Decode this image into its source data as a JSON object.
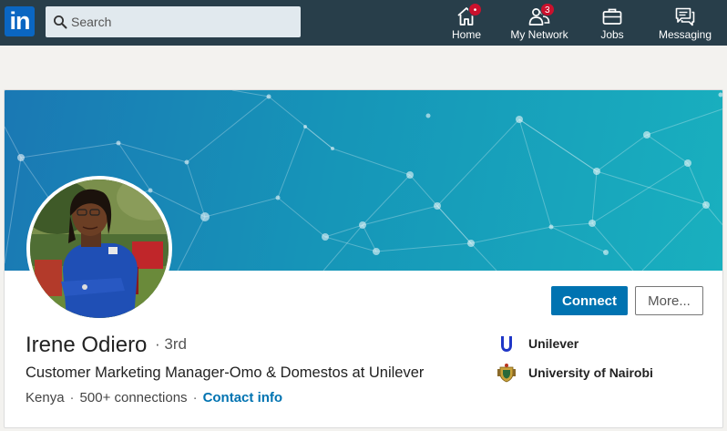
{
  "nav": {
    "logo_text": "in",
    "search_placeholder": "Search",
    "items": [
      {
        "label": "Home",
        "icon": "home-icon",
        "badge": "•"
      },
      {
        "label": "My Network",
        "icon": "network-icon",
        "badge": "3"
      },
      {
        "label": "Jobs",
        "icon": "briefcase-icon"
      },
      {
        "label": "Messaging",
        "icon": "messaging-icon"
      }
    ],
    "colors": {
      "bar": "#283e4a",
      "badge": "#cb112d"
    }
  },
  "profile": {
    "name": "Irene Odiero",
    "degree": "· 3rd",
    "headline": "Customer Marketing Manager-Omo & Domestos at Unilever",
    "location": "Kenya",
    "connections": "500+ connections",
    "contact_link": "Contact info",
    "buttons": {
      "connect": "Connect",
      "more": "More..."
    },
    "organizations": [
      {
        "name": "Unilever",
        "icon": "unilever-logo-icon"
      },
      {
        "name": "University of Nairobi",
        "icon": "university-crest-icon"
      }
    ],
    "colors": {
      "primary": "#0073b1",
      "banner_start": "#1a78b4",
      "banner_end": "#19b0bf"
    }
  }
}
